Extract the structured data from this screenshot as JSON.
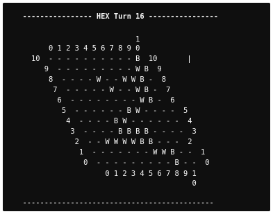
{
  "terminal": {
    "lines": [
      "  ---------------- HEX Turn 16 ----------------",
      "                            1",
      "        0 1 2 3 4 5 6 7 8 9 0",
      "    10  - - - - - - - - - - B  10",
      "       9  - - - - - - - - - W B  9",
      "        8  - - - - W - - W W B -  8",
      "         7  - - - - - W - - W B -  7",
      "          6  - - - - - - - - W B -  6",
      "           5  - - - - - - B W - - - -  5",
      "            4  - - - - B W - - - - - -  4",
      "             3  - - - - B B B B - - - -  3",
      "              2  - - W W W W B B - - -  2",
      "               1  - - - - - - - W W B - -  1",
      "                0  - - - - - - - - - B - -  0",
      "                     0 1 2 3 4 5 6 7 8 9 1",
      "                                         0",
      "",
      "  --------------------------------------------"
    ]
  }
}
